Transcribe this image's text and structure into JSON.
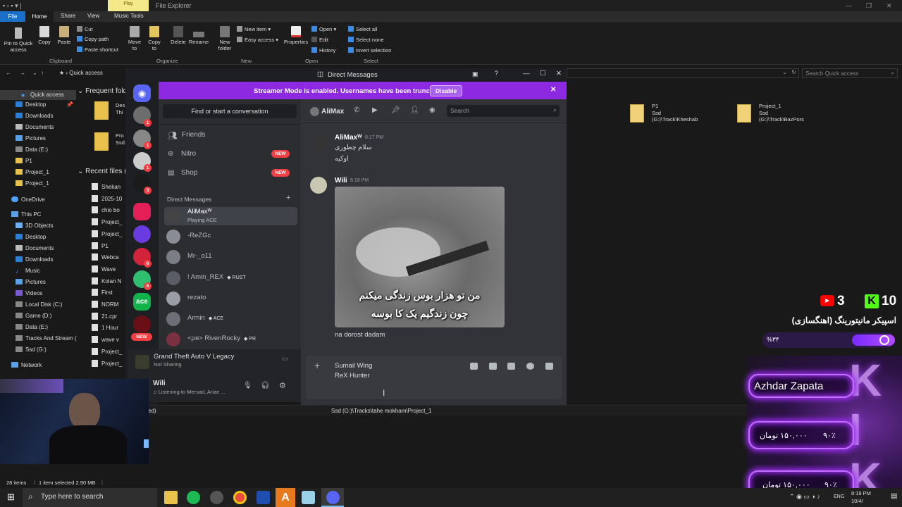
{
  "explorer": {
    "context_tab": "Play",
    "title": "File Explorer",
    "tabs": {
      "file": "File",
      "home": "Home",
      "share": "Share",
      "view": "View",
      "music_tools": "Music Tools"
    },
    "ribbon": {
      "pin": "Pin to Quick access",
      "copy": "Copy",
      "paste": "Paste",
      "cut": "Cut",
      "copy_path": "Copy path",
      "paste_shortcut": "Paste shortcut",
      "move_to": "Move to",
      "copy_to": "Copy to",
      "delete": "Delete",
      "rename": "Rename",
      "new_folder": "New folder",
      "new_item": "New item",
      "easy_access": "Easy access",
      "properties": "Properties",
      "open": "Open",
      "edit": "Edit",
      "history": "History",
      "select_all": "Select all",
      "select_none": "Select none",
      "invert_selection": "Invert selection",
      "groups": {
        "clipboard": "Clipboard",
        "organize": "Organize",
        "new": "New",
        "open": "Open",
        "select": "Select"
      }
    },
    "address": "Quick access",
    "search_placeholder": "Search Quick access",
    "nav": {
      "quick_access": "Quick access",
      "items": [
        "Desktop",
        "Downloads",
        "Documents",
        "Pictures",
        "Data (E:)",
        "P1",
        "Project_1",
        "Project_1"
      ],
      "onedrive": "OneDrive",
      "this_pc": "This PC",
      "pc_items": [
        "3D Objects",
        "Desktop",
        "Documents",
        "Downloads",
        "Music",
        "Pictures",
        "Videos",
        "Local Disk (C:)",
        "Game (D:)",
        "Data (E:)",
        "Tracks And Stream (",
        "Ssd (G:)"
      ],
      "network": "Network"
    },
    "frequent_label": "Frequent fold",
    "recent_label": "Recent files (",
    "frequent_items": [
      "Des",
      "Thi",
      "Pro",
      "Ssd"
    ],
    "recent_items": [
      "Shekan",
      "2025-10",
      "chio bo",
      "Project_",
      "Project_",
      "P1",
      "Webca",
      "Wave",
      "Kolan N",
      "First",
      "NORM",
      "21.cpr",
      "1 Hour",
      "wave v",
      "Project_",
      "Project_"
    ],
    "tiles": [
      {
        "name": "P1",
        "path": "Ssd (G:)\\Track\\Kheshab"
      },
      {
        "name": "Project_1",
        "path": "Ssd (G:)\\Track\\BazPors"
      }
    ],
    "path_left": "ed)",
    "path_text": "Ssd (G:)\\Tracks\\tahe mokham\\Project_1",
    "status": {
      "items": "28 items",
      "selected": "1 item selected  2.90 MB"
    }
  },
  "taskbar": {
    "search_placeholder": "Type here to search",
    "time": "8:19 PM",
    "date": "10/4/",
    "lang": "ENG"
  },
  "discord": {
    "window_title": "Direct Messages",
    "banner": {
      "text": "Streamer Mode is enabled. Usernames have been truncated.",
      "button": "Disable"
    },
    "find_placeholder": "Find or start a conversation",
    "nav": {
      "friends": "Friends",
      "nitro": "Nitro",
      "shop": "Shop",
      "new_badge": "NEW"
    },
    "dm_header": "Direct Messages",
    "dms": [
      {
        "name": "AliMaxᵂ",
        "status": "Playing ACE"
      },
      {
        "name": "-ReZGc"
      },
      {
        "name": "Mr-_o11"
      },
      {
        "name": "! Amin_REX",
        "tag": "RUST"
      },
      {
        "name": "rezato"
      },
      {
        "name": "Armin",
        "tag": "ACE"
      },
      {
        "name": "<ρя> RivenRocky",
        "tag": "PR"
      }
    ],
    "server_badges": [
      "1",
      "1",
      "1",
      "3",
      "6",
      "6"
    ],
    "server_new": "NEW",
    "server_label": "ace",
    "activity": {
      "game": "Grand Theft Auto V Legacy",
      "status": "Not Sharing"
    },
    "user": {
      "name": "Wili",
      "status": "Listening to Mersad, Arian ..."
    },
    "chat_header": {
      "name": "AliMax",
      "search": "Search"
    },
    "messages": [
      {
        "author": "AliMaxᵂ",
        "time": "8:17 PM",
        "lines": [
          "سلام چطوری",
          "اوکیه"
        ]
      },
      {
        "author": "Wili",
        "time": "8:18 PM",
        "image_caption": [
          "من تو هزار بوس زندگی میکنم",
          "چون زندگیم یک کا بوسه"
        ],
        "text": "na dorost dadam"
      }
    ],
    "composer": {
      "line1": "Sumail Wing",
      "line2": "ReX Hunter"
    }
  },
  "overlay": {
    "youtube_count": "3",
    "kick_count": "10",
    "goal_title": "اسپیکر مانیتورینگ (اهنگسازی)",
    "goal_percent": "%۳۴",
    "goal_fraction": 0.34,
    "top_donor": "Azhdar Zapata",
    "donations": [
      {
        "amount": "۱۵۰,۰۰۰ تومان",
        "count": "۹۰٪"
      },
      {
        "amount": "۱۵۰,۰۰۰ تومان",
        "count": "۹۰٪"
      }
    ]
  },
  "colors": {
    "discord_accent": "#8d29e0",
    "discord_bg": "#313338",
    "explorer_blue": "#1a6fc8",
    "neon": "#b44cff",
    "kick_green": "#53fc18",
    "youtube_red": "#ff0000"
  }
}
